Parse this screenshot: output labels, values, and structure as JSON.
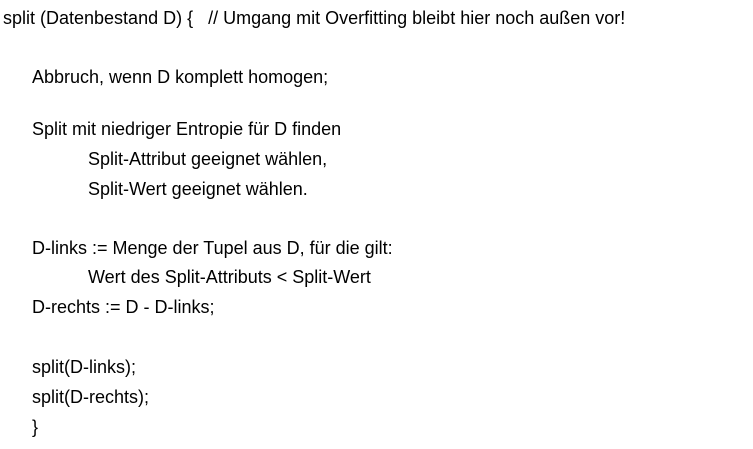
{
  "code": {
    "line_01": "split (Datenbestand D) {   // Umgang mit Overfitting bleibt hier noch außen vor!",
    "line_02": "Abbruch, wenn D komplett homogen;",
    "line_03": "Split mit niedriger Entropie für D finden",
    "line_04": "Split-Attribut geeignet wählen,",
    "line_05": "Split-Wert geeignet wählen.",
    "line_06": "D-links := Menge der Tupel aus D, für die gilt:",
    "line_07": "Wert des Split-Attributs < Split-Wert",
    "line_08": "D-rechts := D - D-links;",
    "line_09": "split(D-links);",
    "line_10": "split(D-rechts);",
    "line_11": "}"
  }
}
